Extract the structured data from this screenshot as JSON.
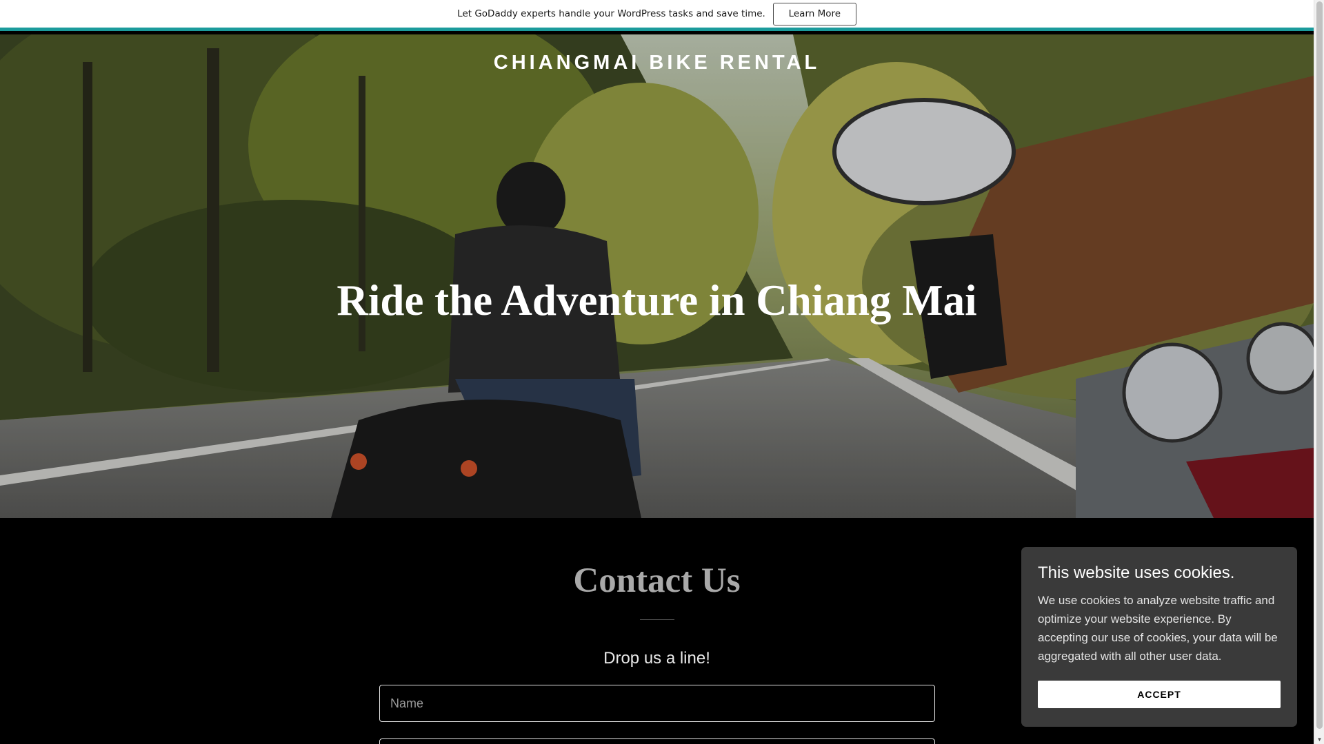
{
  "promo": {
    "text": "Let GoDaddy experts handle your WordPress tasks and save time.",
    "button_label": "Learn More",
    "accent_color": "#1b9b9c"
  },
  "hero": {
    "site_title": "CHIANGMAI BIKE RENTAL",
    "headline": "Ride the Adventure in Chiang Mai",
    "image_subject": "motorcycle-riders-on-forest-road"
  },
  "contact": {
    "title": "Contact Us",
    "subtitle": "Drop us a line!",
    "name_placeholder": "Name"
  },
  "cookie_banner": {
    "title": "This website uses cookies.",
    "body": "We use cookies to analyze website traffic and optimize your website experience. By accepting our use of cookies, your data will be aggregated with all other user data.",
    "accept_label": "ACCEPT"
  }
}
